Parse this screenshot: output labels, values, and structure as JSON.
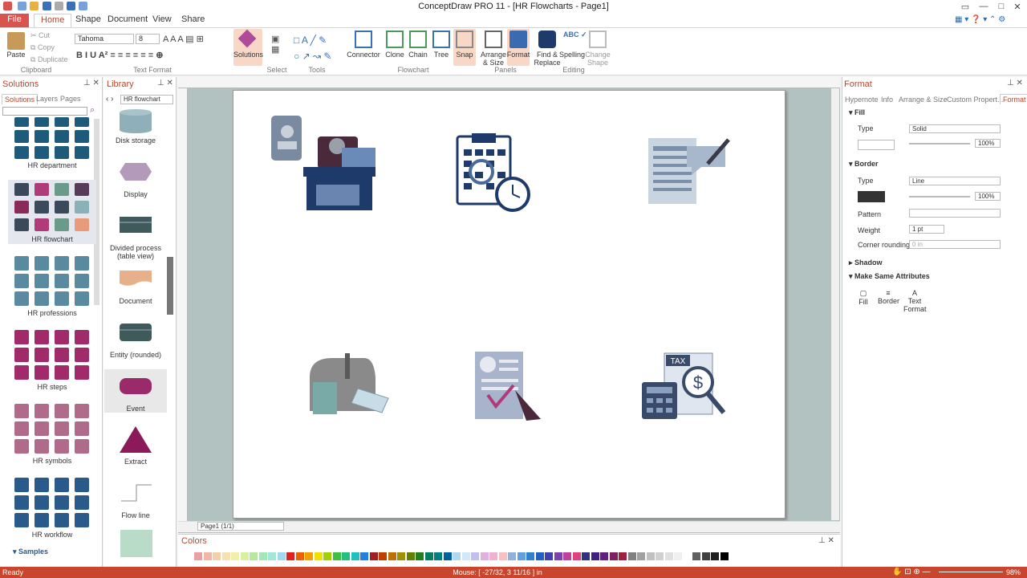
{
  "app": {
    "title": "ConceptDraw PRO 11 - [HR Flowcharts - Page1]"
  },
  "tabs": [
    "File",
    "Home",
    "Shape",
    "Document",
    "View",
    "Share"
  ],
  "ribbon": {
    "clipboard": {
      "paste": "Paste",
      "cut": "Cut",
      "copy": "Copy",
      "duplicate": "Duplicate",
      "group": "Clipboard"
    },
    "text_format": {
      "font": "Tahoma",
      "size": "8",
      "group": "Text Format"
    },
    "solutions": "Solutions",
    "select_group": "Select",
    "tools_group": "Tools",
    "flowchart": {
      "connector": "Connector",
      "clone": "Clone",
      "chain": "Chain",
      "tree": "Tree",
      "snap": "Snap",
      "group": "Flowchart"
    },
    "panels": {
      "arrange": "Arrange & Size",
      "format": "Format",
      "group": "Panels"
    },
    "editing": {
      "find": "Find & Replace",
      "spelling": "Spelling",
      "change_shape": "Change Shape",
      "group": "Editing"
    }
  },
  "solutions_panel": {
    "title": "Solutions",
    "tabs": [
      "Solutions",
      "Layers",
      "Pages"
    ],
    "groups": [
      "HR department",
      "HR flowchart",
      "HR professions",
      "HR steps",
      "HR symbols",
      "HR workflow"
    ],
    "samples": "Samples"
  },
  "library_panel": {
    "title": "Library",
    "selected": "HR flowchart",
    "items": [
      "Disk storage",
      "Display",
      "Divided process (table view)",
      "Document",
      "Entity (rounded)",
      "Event",
      "Extract",
      "Flow line"
    ]
  },
  "canvas": {
    "page_label": "Page1 (1/1)"
  },
  "colors_panel": {
    "title": "Colors"
  },
  "format_panel": {
    "title": "Format",
    "tabs": [
      "Hypernote",
      "Info",
      "Arrange & Size",
      "Custom Propert...",
      "Format"
    ],
    "fill": {
      "header": "Fill",
      "type_label": "Type",
      "type_value": "Solid",
      "opacity": "100%"
    },
    "border": {
      "header": "Border",
      "type_label": "Type",
      "type_value": "Line",
      "opacity": "100%",
      "pattern_label": "Pattern",
      "weight_label": "Weight",
      "weight_value": "1 pt",
      "rounding_label": "Corner rounding",
      "rounding_value": "0 in"
    },
    "shadow": "Shadow",
    "make_same": "Make Same Attributes",
    "make_same_items": [
      "Fill",
      "Border",
      "Text Format"
    ]
  },
  "status": {
    "left": "Ready",
    "mouse": "Mouse: [ -27/32, 3 11/16 ] in",
    "zoom": "98%"
  },
  "colors": {
    "accent": "#c7462d",
    "palette": [
      "#e8a0a0",
      "#f0b8a0",
      "#f4d0a8",
      "#f8e0b0",
      "#f0f0a8",
      "#d8f0a0",
      "#b8e8a0",
      "#a0e8b8",
      "#a0e8d8",
      "#a0d8f0",
      "#e02020",
      "#f06000",
      "#f0a000",
      "#f0e000",
      "#a0d000",
      "#40c040",
      "#20c080",
      "#20c0c0",
      "#2080e0",
      "#a02020",
      "#c04000",
      "#c07000",
      "#a09000",
      "#608000",
      "#208020",
      "#008060",
      "#008080",
      "#0060a0",
      "#b0d8f0",
      "#d0e8f8",
      "#c0c0f0",
      "#e0b0e0",
      "#f0b0d0",
      "#f8c0c0",
      "#90b0e0",
      "#60a0e0",
      "#3080d0",
      "#2060c0",
      "#4040b0",
      "#8040b0",
      "#c040a0",
      "#e04080",
      "#303080",
      "#402080",
      "#602080",
      "#802060",
      "#a02040",
      "#808080",
      "#a0a0a0",
      "#c0c0c0",
      "#d0d0d0",
      "#e0e0e0",
      "#f0f0f0",
      "#ffffff",
      "#606060",
      "#404040",
      "#202020",
      "#000000"
    ]
  }
}
